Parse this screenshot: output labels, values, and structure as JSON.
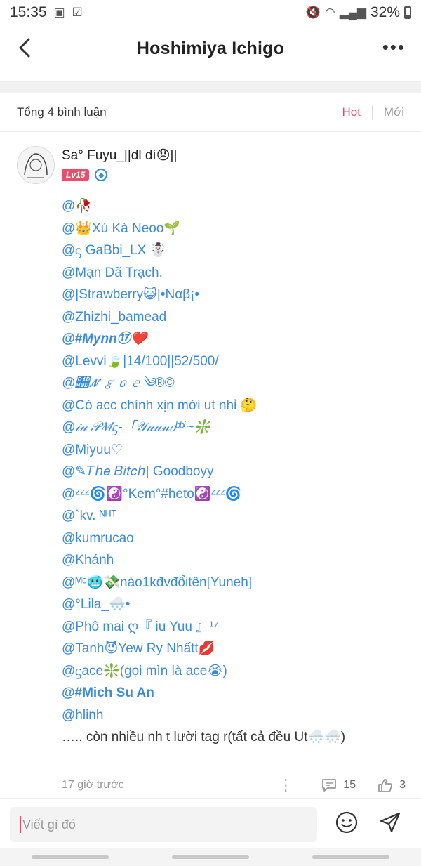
{
  "status_bar": {
    "time": "15:35",
    "battery": "32%"
  },
  "header": {
    "title": "Hoshimiya Ichigo"
  },
  "comments_bar": {
    "total": "Tổng 4 bình luận",
    "sort_hot": "Hot",
    "sort_new": "Mới"
  },
  "comment": {
    "author": "Sa° Fuyu_||dl dí😞||",
    "level": "Lv15",
    "mentions": [
      {
        "text": "@🥀"
      },
      {
        "text": "@👑Xú Kà Neoo🌱"
      },
      {
        "text": "@ᦓ GaBbi_LX ☃️"
      },
      {
        "text": "@Mạn Dã Trạch."
      },
      {
        "text": "@|Strawberry😺|•Nαβ¡•"
      },
      {
        "text": "@Zhizhi_bamead"
      },
      {
        "text": "@#Mynn⑰❤️"
      },
      {
        "text": "@Levvi🍃|14/100||52/500/"
      },
      {
        "text": "@𝒝𝒩𝑔𝑜𝑒༄®©"
      },
      {
        "text": "@Có acc chính xịn mới ut nhỉ 🤔"
      },
      {
        "text": "@𝒾𝓊 𝒫𝑀ᦓ-「𝒴𝓊𝓊𝓃𝑜ᵇᵇⁱ~❇️"
      },
      {
        "text": "@Miyuu♡"
      },
      {
        "text": "@✎𝑇ℎ𝑒 𝐵𝑖𝑡𝑐ℎ| Goodboyy"
      },
      {
        "text": "@ᶻᶻᶻ🌀☯️°Kem°#heto☯️ᶻᶻᶻ🌀"
      },
      {
        "text": "@`kv. ᴺᴴᵀ"
      },
      {
        "text": "@kumrucao"
      },
      {
        "text": "@Khánh"
      },
      {
        "text": "@ᴹᶜ🥶💸nào1kđvđổitên[Yuneh]"
      },
      {
        "text": "@°Lila_🌨️•"
      },
      {
        "text": "@Phô mai ღ『 iu Yuu 』¹⁷"
      },
      {
        "text": "@Tanh😈Yew Ry Nhấtt💋"
      },
      {
        "text": "@ᦓace❇️(gọi mìn là ace😭)"
      },
      {
        "text": "@#Mich Su An"
      },
      {
        "text": "@hlinh"
      }
    ],
    "trailing": "….. còn nhiều nh t lười tag r(tất cả đều Ut🌨️🌨️)",
    "timestamp": "17 giờ trước",
    "reply_count": "15",
    "like_count": "3"
  },
  "input": {
    "placeholder": "Viết gì đó"
  },
  "icons": {
    "back": "chevron-left-icon",
    "more": "more-horizontal-icon",
    "reply": "comment-icon",
    "like": "thumbs-up-icon",
    "emoji": "emoji-icon",
    "send": "send-icon"
  },
  "colors": {
    "accent": "#e94a6b",
    "mention": "#3c8bd9",
    "muted": "#999999"
  }
}
